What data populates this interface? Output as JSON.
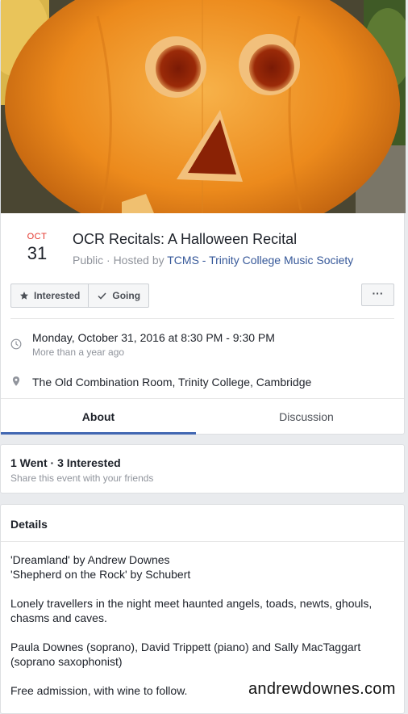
{
  "event": {
    "month": "OCT",
    "day": "31",
    "title": "OCR Recitals: A Halloween Recital",
    "privacy": "Public · Hosted by",
    "host": "TCMS - Trinity College Music Society"
  },
  "actions": {
    "interested_label": "Interested",
    "going_label": "Going",
    "more_label": "···"
  },
  "when": {
    "time": "Monday, October 31, 2016 at 8:30 PM - 9:30 PM",
    "relative": "More than a year ago"
  },
  "where": {
    "place": "The Old Combination Room, Trinity College, Cambridge"
  },
  "tabs": [
    {
      "label": "About",
      "active": true
    },
    {
      "label": "Discussion",
      "active": false
    }
  ],
  "stats": {
    "summary": "1 Went · 3 Interested",
    "share": "Share this event with your friends"
  },
  "details": {
    "heading": "Details",
    "line1": "'Dreamland' by Andrew Downes",
    "line2": "'Shepherd on the Rock' by Schubert",
    "para2": "Lonely travellers in the night meet haunted angels, toads, newts, ghouls, chasms and caves.",
    "para3": "Paula Downes (soprano), David Trippett (piano) and Sally MacTaggart (soprano saxophonist)",
    "para4": "Free admission, with wine to follow."
  },
  "watermark": "andrewdownes.com",
  "colors": {
    "accent": "#4267b2",
    "link": "#365899",
    "month": "#e4342b",
    "muted": "#90949c"
  }
}
